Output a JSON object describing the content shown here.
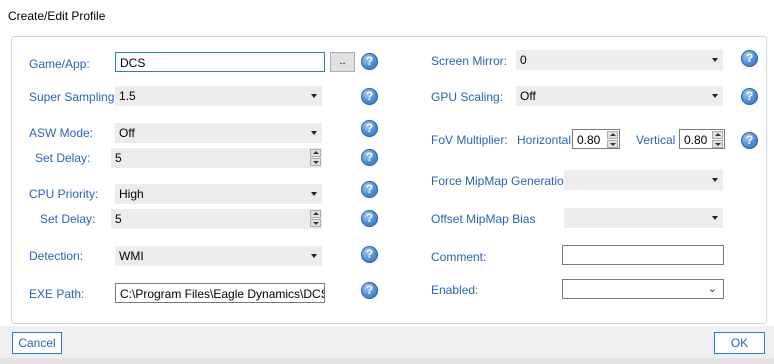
{
  "window": {
    "title": "Create/Edit Profile"
  },
  "left": {
    "game_label": "Game/App:",
    "game_value": "DCS",
    "browse_label": "..",
    "supersampling_label": "Super Sampling:",
    "supersampling_value": "1.5",
    "asw_label": "ASW Mode:",
    "asw_value": "Off",
    "asw_delay_label": "Set Delay:",
    "asw_delay_value": "5",
    "cpu_label": "CPU Priority:",
    "cpu_value": "High",
    "cpu_delay_label": "Set Delay:",
    "cpu_delay_value": "5",
    "detection_label": "Detection:",
    "detection_value": "WMI",
    "exe_label": "EXE Path:",
    "exe_value": "C:\\Program Files\\Eagle Dynamics\\DCS"
  },
  "right": {
    "mirror_label": "Screen Mirror:",
    "mirror_value": "0",
    "gpu_label": "GPU Scaling:",
    "gpu_value": "Off",
    "fov_label": "FoV Multiplier:",
    "horizontal_label": "Horizontal",
    "horizontal_value": "0.80",
    "vertical_label": "Vertical",
    "vertical_value": "0.80",
    "mipmap_label": "Force MipMap Generation",
    "mipmap_value": "",
    "offset_label": "Offset MipMap Bias",
    "offset_value": "",
    "comment_label": "Comment:",
    "comment_value": "",
    "enabled_label": "Enabled:",
    "enabled_value": ""
  },
  "help_glyph": "?",
  "footer": {
    "cancel_label": "Cancel",
    "ok_label": "OK"
  },
  "icons": {
    "help": "help-icon",
    "dropdown": "dropdown-arrow-icon",
    "chevron": "chevron-down-icon"
  },
  "colors": {
    "label": "#2a63b8",
    "accent": "#2b7ad9",
    "field_bg": "#ececec"
  }
}
